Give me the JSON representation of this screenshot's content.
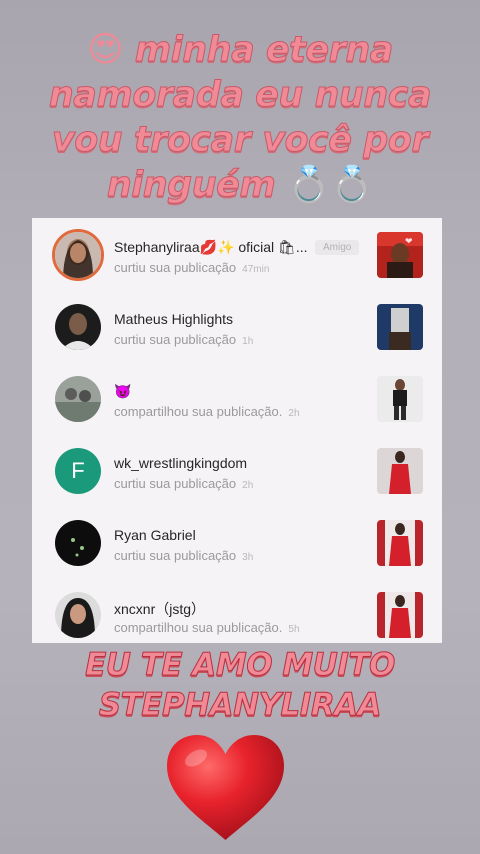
{
  "caption_top": {
    "emoji": "😍",
    "text": "minha eterna namorada eu nunca vou trocar você por ninguém",
    "rings": "💍💍"
  },
  "notifications": [
    {
      "name": "Stephanyliraa💋✨ oficial 🛍...",
      "action": "curtiu sua publicação",
      "time": "47min",
      "badge": "Amigo"
    },
    {
      "name": "Matheus Highlights",
      "action": "curtiu sua publicação",
      "time": "1h"
    },
    {
      "name": "😈",
      "action": "compartilhou sua publicação.",
      "time": "2h"
    },
    {
      "name": "wk_wrestlingkingdom",
      "action": "curtiu sua publicação",
      "time": "2h",
      "avatar_letter": "F"
    },
    {
      "name": "Ryan Gabriel",
      "action": "curtiu sua publicação",
      "time": "3h"
    },
    {
      "name": "xncxnr（jstg）",
      "action": "compartilhou sua publicação.",
      "time": "5h"
    }
  ],
  "caption_bottom": {
    "line1": "EU TE AMO MUITO",
    "line2": "STEPHANYLIRAA"
  },
  "icons": [
    "heart-icon"
  ],
  "colors": {
    "caption": "#f08a96",
    "heart": "#e8232c",
    "ring": "#e06a3b",
    "letter_avatar": "#1a9a7a"
  }
}
